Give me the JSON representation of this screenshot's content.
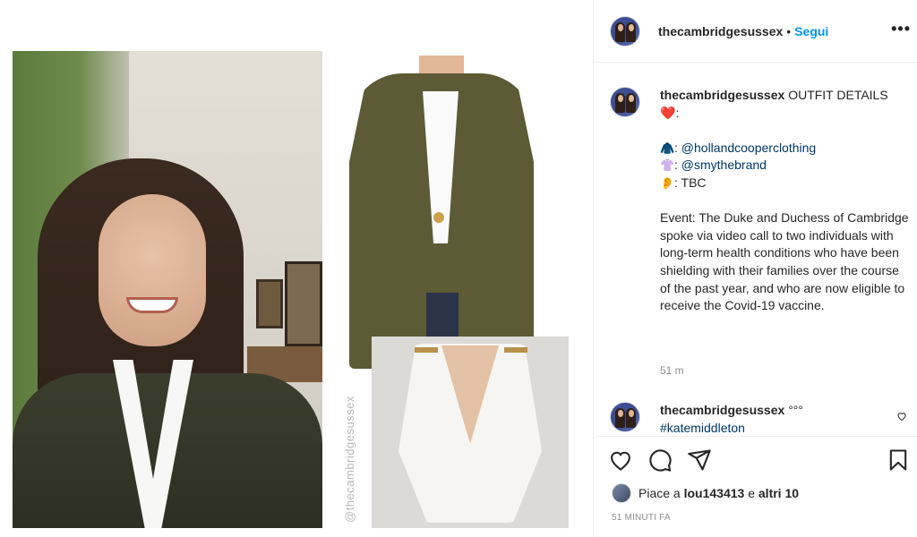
{
  "post": {
    "username": "thecambridgesussex",
    "follow_label": "Segui",
    "separator": "•",
    "more_label": "•••",
    "watermark": "@thecambridgesussex"
  },
  "caption": {
    "username": "thecambridgesussex",
    "title": "OUTFIT DETAILS",
    "heart": "❤️",
    "colon": ":",
    "items": [
      {
        "icon": "jacket-emoji",
        "glyph": "🧥",
        "text": "@hollandcooperclothing"
      },
      {
        "icon": "shirt-emoji",
        "glyph": "👚",
        "text": "@smythebrand"
      },
      {
        "icon": "ear-emoji",
        "glyph": "👂",
        "text": "TBC"
      }
    ],
    "event_text": "Event: The Duke and Duchess of Cambridge spoke via video call to two individuals with long-term health conditions who have been shielding with their families over the course of the past year, and who are now eligible to receive the Covid-19 vaccine.",
    "time": "51 m"
  },
  "comment": {
    "username": "thecambridgesussex",
    "suffix": "°°°",
    "hashtag": "#katemiddleton"
  },
  "likes": {
    "prefix": "Piace a",
    "user": "lou143413",
    "connector": "e",
    "others": "altri 10"
  },
  "timestamp": "51 minuti fa",
  "colors": {
    "link": "#0095f6",
    "mention": "#00376b",
    "muted": "#8e8e8e",
    "heart": "#e0245e"
  },
  "icons": [
    "heart-icon",
    "comment-icon",
    "share-icon",
    "bookmark-icon",
    "more-icon"
  ]
}
